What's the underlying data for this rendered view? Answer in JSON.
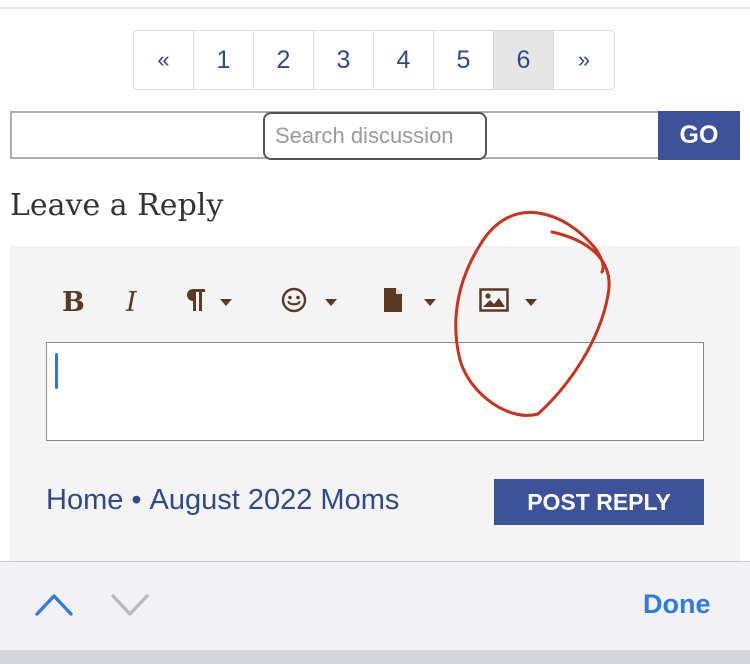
{
  "pagination": {
    "prev": "«",
    "pages": [
      "1",
      "2",
      "3",
      "4",
      "5",
      "6"
    ],
    "next": "»",
    "current": "6"
  },
  "search": {
    "placeholder": "Search discussion",
    "go_label": "GO"
  },
  "reply": {
    "title": "Leave a Reply"
  },
  "toolbar": {
    "bold_label": "B",
    "italic_label": "I"
  },
  "footer": {
    "home": "Home",
    "separator": "•",
    "forum": "August 2022 Moms",
    "post_reply": "POST REPLY"
  },
  "keyboard_bar": {
    "done": "Done"
  },
  "colors": {
    "accent": "#3d5298",
    "link": "#2f4a8a",
    "icon": "#5b3a25",
    "done": "#2f7be0",
    "annotation": "#c8321e"
  },
  "icons": [
    "paragraph-icon",
    "emoji-icon",
    "file-icon",
    "image-icon",
    "chevron-up-icon",
    "chevron-down-icon"
  ]
}
